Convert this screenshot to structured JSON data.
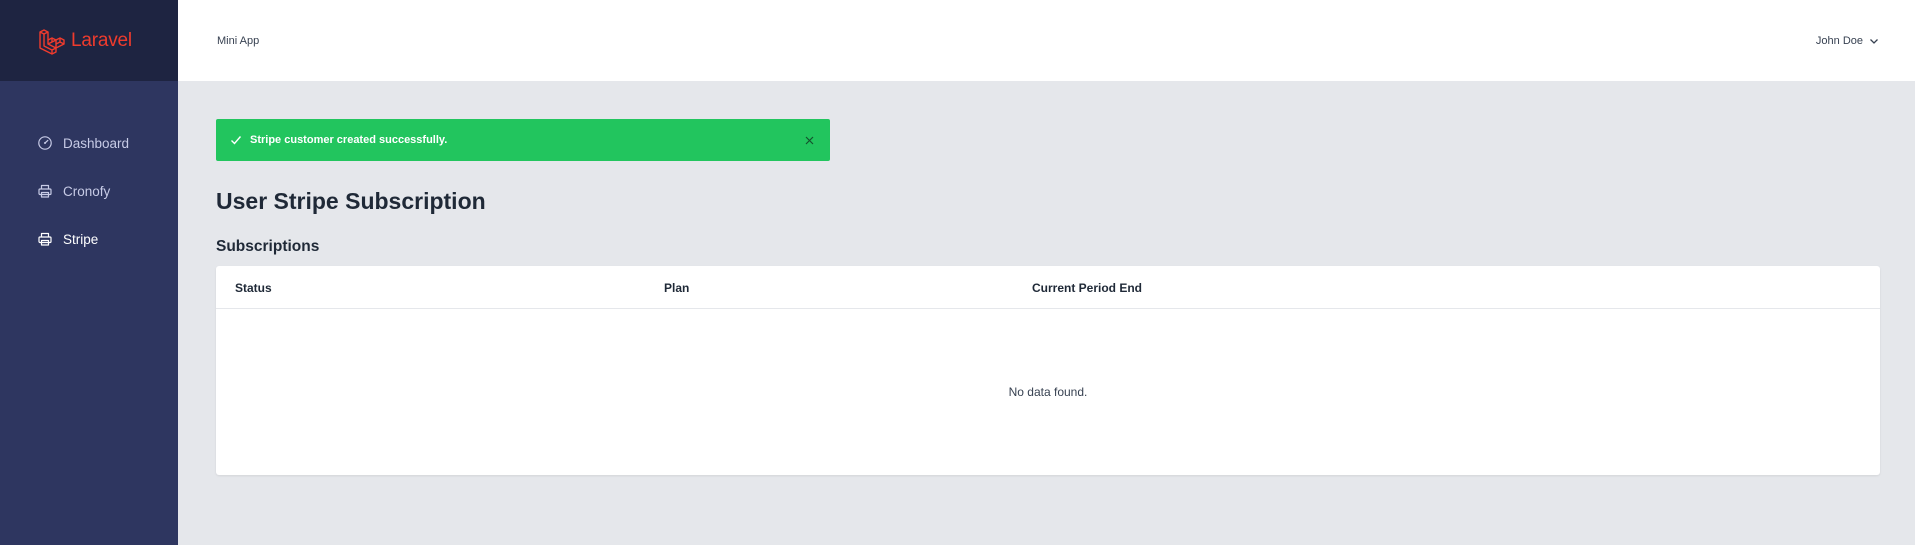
{
  "sidebar": {
    "brand": {
      "name": "Laravel",
      "icon": "laravel-logo-icon",
      "color": "#ef3b2d"
    },
    "items": [
      {
        "label": "Dashboard",
        "icon": "speedometer-icon",
        "active": false
      },
      {
        "label": "Cronofy",
        "icon": "printer-icon",
        "active": false
      },
      {
        "label": "Stripe",
        "icon": "printer-icon",
        "active": true
      }
    ]
  },
  "header": {
    "app_name": "Mini App",
    "user_name": "John Doe",
    "user_menu_icon": "chevron-down-icon"
  },
  "alert": {
    "message": "Stripe customer created successfully.",
    "type": "success",
    "color": "#22c55e",
    "icon": "check-icon",
    "close_icon": "close-icon"
  },
  "main": {
    "page_title": "User Stripe Subscription",
    "section_title": "Subscriptions",
    "table": {
      "columns": [
        "Status",
        "Plan",
        "Current Period End"
      ],
      "rows": [],
      "empty_message": "No data found."
    }
  },
  "colors": {
    "sidebar_bg": "#2e3660",
    "brand_bg": "#1e2441",
    "content_bg": "#e5e7eb"
  }
}
